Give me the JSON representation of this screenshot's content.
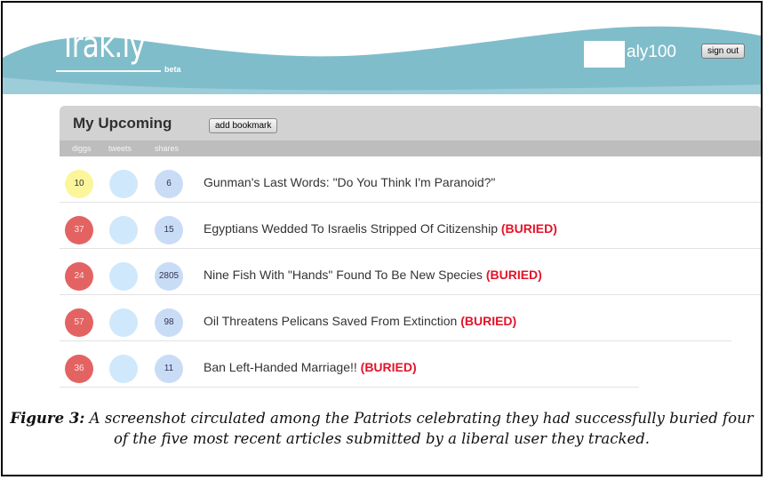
{
  "header": {
    "logo": "Trak.ly",
    "beta": "beta",
    "username": "aly100",
    "signout_label": "sign out",
    "brand_color": "#7fbdcc"
  },
  "panel": {
    "title": "My Upcoming",
    "add_bookmark_label": "add bookmark",
    "columns": [
      "diggs",
      "tweets",
      "shares"
    ]
  },
  "items": [
    {
      "diggs": "10",
      "tweets": "",
      "shares": "6",
      "title": "Gunman's Last Words: \"Do You Think I'm Paranoid?\"",
      "status": ""
    },
    {
      "diggs": "37",
      "tweets": "",
      "shares": "15",
      "title": "Egyptians Wedded To Israelis Stripped Of Citizenship",
      "status": "(BURIED)"
    },
    {
      "diggs": "24",
      "tweets": "",
      "shares": "2805",
      "title": "Nine Fish With \"Hands\" Found To Be New Species",
      "status": "(BURIED)"
    },
    {
      "diggs": "57",
      "tweets": "",
      "shares": "98",
      "title": "Oil Threatens Pelicans Saved From Extinction",
      "status": "(BURIED)"
    },
    {
      "diggs": "36",
      "tweets": "",
      "shares": "11",
      "title": "Ban Left-Handed Marriage!!",
      "status": "(BURIED)"
    }
  ],
  "caption": {
    "label": "Figure 3:",
    "text": "A screenshot circulated among the Patriots celebrating they had successfully buried four of the five most recent articles submitted by a liberal user they tracked."
  }
}
